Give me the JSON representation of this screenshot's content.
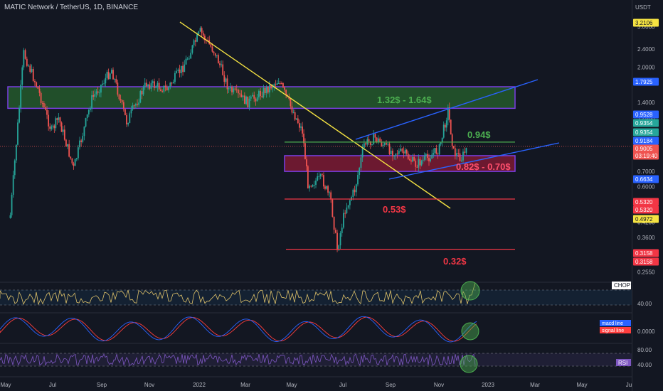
{
  "header": {
    "symbol_title": "MATIC Network / TetherUS, 1D, BINANCE",
    "currency": "USDT"
  },
  "colors": {
    "background": "#131722",
    "up": "#26a69a",
    "down": "#ef5350",
    "trendline_yellow": "#f5e342",
    "channel_blue": "#2962ff",
    "zone_green": "#2e7d32",
    "zone_red": "#b71c3c",
    "zone_border": "#7b3fe4",
    "chop_line": "#e0c36a",
    "rsi_line": "#7e57c2",
    "macd_line": "#2962ff",
    "signal_line": "#ff3d3d",
    "level_label_green": "#4caf50",
    "level_label_red": "#f23645"
  },
  "chart_data": {
    "type": "candlestick",
    "title": "MATIC Network / TetherUS, 1D, BINANCE",
    "scale": "log",
    "y_unit": "USDT",
    "ylim": [
      0.25,
      3.3
    ],
    "x_ticks": [
      "May",
      "Jul",
      "Sep",
      "Nov",
      "2022",
      "Mar",
      "May",
      "Jul",
      "Sep",
      "Nov",
      "2023",
      "Mar",
      "May",
      "Ju"
    ],
    "y_ticks": [
      "3.0000",
      "2.4000",
      "2.0000",
      "1.7000",
      "1.4000",
      "1.2000",
      "0.7000",
      "0.6000",
      "0.4200",
      "0.3600",
      "0.2550"
    ],
    "price_path": [
      {
        "date": "2021-05-01",
        "price": 0.45
      },
      {
        "date": "2021-05-18",
        "price": 2.3
      },
      {
        "date": "2021-06-05",
        "price": 1.6
      },
      {
        "date": "2021-06-22",
        "price": 1.05
      },
      {
        "date": "2021-07-01",
        "price": 1.2
      },
      {
        "date": "2021-07-20",
        "price": 0.72
      },
      {
        "date": "2021-08-12",
        "price": 1.45
      },
      {
        "date": "2021-09-06",
        "price": 1.95
      },
      {
        "date": "2021-09-25",
        "price": 1.15
      },
      {
        "date": "2021-10-20",
        "price": 1.7
      },
      {
        "date": "2021-11-15",
        "price": 1.6
      },
      {
        "date": "2021-12-05",
        "price": 2.0
      },
      {
        "date": "2021-12-27",
        "price": 2.85
      },
      {
        "date": "2022-01-15",
        "price": 2.3
      },
      {
        "date": "2022-02-01",
        "price": 1.6
      },
      {
        "date": "2022-02-25",
        "price": 1.4
      },
      {
        "date": "2022-03-15",
        "price": 1.55
      },
      {
        "date": "2022-04-05",
        "price": 1.75
      },
      {
        "date": "2022-04-20",
        "price": 1.35
      },
      {
        "date": "2022-05-05",
        "price": 1.05
      },
      {
        "date": "2022-05-12",
        "price": 0.62
      },
      {
        "date": "2022-05-30",
        "price": 0.65
      },
      {
        "date": "2022-06-10",
        "price": 0.52
      },
      {
        "date": "2022-06-18",
        "price": 0.32
      },
      {
        "date": "2022-06-28",
        "price": 0.48
      },
      {
        "date": "2022-07-10",
        "price": 0.58
      },
      {
        "date": "2022-07-22",
        "price": 0.92
      },
      {
        "date": "2022-08-05",
        "price": 0.98
      },
      {
        "date": "2022-08-25",
        "price": 0.86
      },
      {
        "date": "2022-09-10",
        "price": 0.84
      },
      {
        "date": "2022-09-25",
        "price": 0.75
      },
      {
        "date": "2022-10-10",
        "price": 0.8
      },
      {
        "date": "2022-10-25",
        "price": 0.88
      },
      {
        "date": "2022-11-05",
        "price": 1.3
      },
      {
        "date": "2022-11-12",
        "price": 0.85
      },
      {
        "date": "2022-11-22",
        "price": 0.8
      },
      {
        "date": "2022-11-30",
        "price": 0.9
      }
    ],
    "zones": [
      {
        "label": "1.32$ - 1.64$",
        "low": 1.32,
        "high": 1.64,
        "color": "green"
      },
      {
        "label": "0.82$ - 0.70$",
        "low": 0.7,
        "high": 0.82,
        "color": "red"
      }
    ],
    "levels": [
      {
        "label": "0.94$",
        "value": 0.94,
        "color": "green"
      },
      {
        "label": "0.53$",
        "value": 0.53,
        "color": "red"
      },
      {
        "label": "0.32$",
        "value": 0.32,
        "color": "red"
      }
    ],
    "price_tags": [
      {
        "text": "3.2106",
        "bg": "#f5e342",
        "fg": "#131722"
      },
      {
        "text": "1.7925",
        "bg": "#2962ff",
        "fg": "#ffffff"
      },
      {
        "text": "0.9528",
        "bg": "#2962ff",
        "fg": "#ffffff"
      },
      {
        "text": "0.9354",
        "bg": "#26a69a",
        "fg": "#ffffff"
      },
      {
        "text": "0.9354",
        "bg": "#26a69a",
        "fg": "#ffffff"
      },
      {
        "text": "0.9184",
        "bg": "#2962ff",
        "fg": "#ffffff"
      },
      {
        "text": "0.9005",
        "bg": "#ef5350",
        "fg": "#ffffff"
      },
      {
        "text": "03:19:40",
        "bg": "#ef5350",
        "fg": "#ffffff"
      },
      {
        "text": "0.6634",
        "bg": "#2962ff",
        "fg": "#ffffff"
      },
      {
        "text": "0.5320",
        "bg": "#f23645",
        "fg": "#ffffff"
      },
      {
        "text": "0.5320",
        "bg": "#f23645",
        "fg": "#ffffff"
      },
      {
        "text": "0.4972",
        "bg": "#f5e342",
        "fg": "#131722"
      },
      {
        "text": "0.3158",
        "bg": "#f23645",
        "fg": "#ffffff"
      },
      {
        "text": "0.3158",
        "bg": "#f23645",
        "fg": "#ffffff"
      }
    ]
  },
  "indicators": {
    "chop": {
      "name": "CHOP",
      "axis_label": "40.00"
    },
    "macd": {
      "macd_label": "macd line",
      "signal_label": "signal line",
      "axis_label": "0.0000"
    },
    "rsi": {
      "name": "RSI",
      "axis_labels": [
        "80.00",
        "40.00"
      ]
    }
  }
}
